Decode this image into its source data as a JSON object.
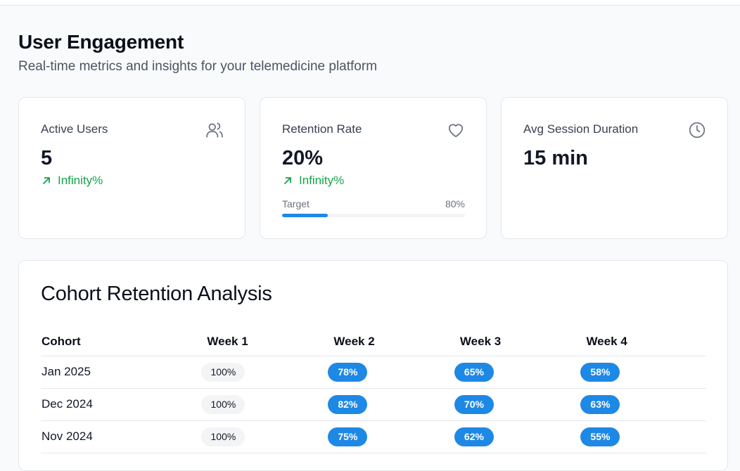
{
  "header": {
    "title": "User Engagement",
    "subtitle": "Real-time metrics and insights for your telemedicine platform"
  },
  "metrics": [
    {
      "label": "Active Users",
      "value": "5",
      "trend": "Infinity%",
      "icon": "users-icon"
    },
    {
      "label": "Retention Rate",
      "value": "20%",
      "trend": "Infinity%",
      "icon": "heart-icon",
      "target_label": "Target",
      "target_value": "80%",
      "progress_percent": 25
    },
    {
      "label": "Avg Session Duration",
      "value": "15 min",
      "icon": "clock-icon"
    }
  ],
  "cohort": {
    "title": "Cohort Retention Analysis",
    "columns": [
      "Cohort",
      "Week 1",
      "Week 2",
      "Week 3",
      "Week 4"
    ],
    "rows": [
      {
        "cohort": "Jan 2025",
        "w1": "100%",
        "w2": "78%",
        "w3": "65%",
        "w4": "58%"
      },
      {
        "cohort": "Dec 2024",
        "w1": "100%",
        "w2": "82%",
        "w3": "70%",
        "w4": "63%"
      },
      {
        "cohort": "Nov 2024",
        "w1": "100%",
        "w2": "75%",
        "w3": "62%",
        "w4": "55%"
      }
    ]
  },
  "colors": {
    "accent": "#1e88e5",
    "positive": "#16a34a",
    "muted_pill": "#f3f4f6"
  }
}
